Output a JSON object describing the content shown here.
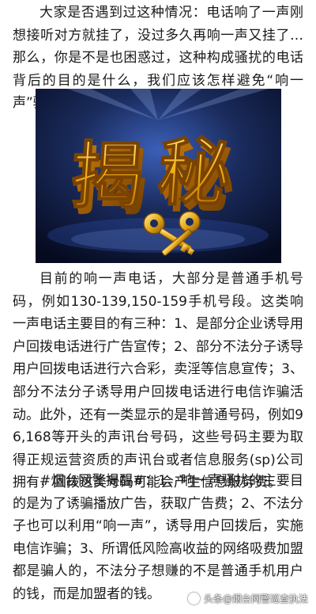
{
  "article": {
    "paragraph_1": "大家是否遇到过这种情况：电话响了一声刚想接听对方就挂了，没过多久再响一声又挂了…那么，你是不是也困惑过，这种构成骚扰的电话背后的目的是什么，我们应该怎样避免“响一声”骚扰？",
    "hero_image": {
      "title_text": "揭秘",
      "colors": {
        "background_top": "#1a2b5c",
        "background_bottom": "#050a1f",
        "glyph_gold": "#f3b21b",
        "glyph_highlight": "#ffe37a"
      }
    },
    "paragraph_2": "目前的响一声电话，大部分是普通手机号码，例如130-139,150-159手机号段。这类响一声电话主要目的有三种：1、是部分企业诱导用户回拨电话进行广告宣传；2、部分不法分子诱导用户回拨电话进行六合彩，卖淫等信息宣传；3、部分不法分子诱导用户回拨电话进行电信诈骗活动。此外，还有一类显示的是非普通号码，例如96,168等开头的声讯台号码，这些号码主要为取得正规运营资质的声讯台或者信息服务(sp)公司拥有，回拨这类号码可能会产生信息服务费。",
    "paragraph_3": "#烟台网警提醒#：1、响一声骚扰的主要目的是为了诱骗播放广告，获取广告费；2、不法分子也可以利用“响一声”，诱导用户回拨后，实施电信诈骗；3、所谓低风险高收益的网络吸费加盟都是骗人的，不法分子想赚的不是普通手机用户的钱，而是加盟者的钱。"
  },
  "watermark": {
    "text": "头条@烟台网警巡查执法",
    "icon": "toutiao-logo-icon"
  }
}
